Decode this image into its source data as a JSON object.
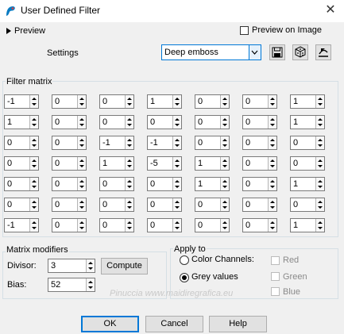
{
  "window": {
    "title": "User Defined Filter",
    "close_glyph": "✕"
  },
  "preview": {
    "label": "Preview",
    "preview_on_image_label": "Preview on Image",
    "preview_on_image_checked": false
  },
  "settings": {
    "label": "Settings",
    "preset_value": "Deep emboss"
  },
  "filter_matrix": {
    "title": "Filter matrix",
    "rows": [
      [
        "-1",
        "0",
        "0",
        "1",
        "0",
        "0",
        "1"
      ],
      [
        "1",
        "0",
        "0",
        "0",
        "0",
        "0",
        "1"
      ],
      [
        "0",
        "0",
        "-1",
        "-1",
        "0",
        "0",
        "0"
      ],
      [
        "0",
        "0",
        "1",
        "-5",
        "1",
        "0",
        "0"
      ],
      [
        "0",
        "0",
        "0",
        "0",
        "1",
        "0",
        "1"
      ],
      [
        "0",
        "0",
        "0",
        "0",
        "0",
        "0",
        "0"
      ],
      [
        "-1",
        "0",
        "0",
        "0",
        "0",
        "0",
        "1"
      ]
    ]
  },
  "matrix_modifiers": {
    "title": "Matrix modifiers",
    "divisor_label": "Divisor:",
    "divisor_value": "3",
    "bias_label": "Bias:",
    "bias_value": "52",
    "compute_label": "Compute"
  },
  "apply_to": {
    "title": "Apply to",
    "color_channels_label": "Color Channels:",
    "grey_values_label": "Grey values",
    "selected": "grey_values",
    "channels": [
      {
        "label": "Red",
        "checked": false,
        "enabled": false
      },
      {
        "label": "Green",
        "checked": false,
        "enabled": false
      },
      {
        "label": "Blue",
        "checked": false,
        "enabled": false
      }
    ]
  },
  "buttons": {
    "ok": "OK",
    "cancel": "Cancel",
    "help": "Help"
  },
  "watermark": "Pinuccia www.maidiregrafica.eu",
  "colors": {
    "accent": "#0078d7",
    "background": "#f0f0f0"
  }
}
